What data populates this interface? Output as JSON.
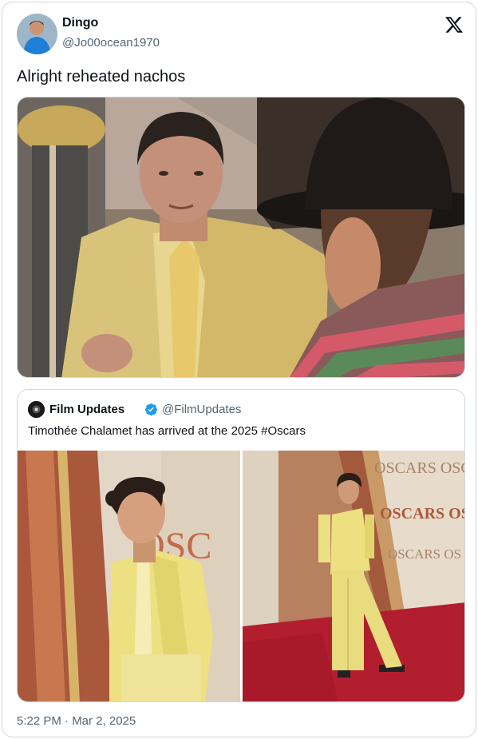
{
  "tweet": {
    "display_name": "Dingo",
    "handle": "@Jo00ocean1970",
    "text": "Alright reheated nachos",
    "timestamp": "5:22 PM · Mar 2, 2025",
    "logo_icon": "x-logo-icon",
    "avatar_icon": "avatar-icon",
    "media_photo": "movie-still-photo"
  },
  "quoted_tweet": {
    "display_name": "Film Updates",
    "verified_icon": "verified-badge-icon",
    "handle": "@FilmUpdates",
    "text": "Timothée Chalamet has arrived at the 2025 #Oscars",
    "media": [
      {
        "photo": "red-carpet-photo-closeup",
        "wall_text": "OSC"
      },
      {
        "photo": "red-carpet-photo-fullbody",
        "wall_text": [
          "OSCARS OSC",
          "OSCARS OSC",
          "OSCARS OS"
        ]
      }
    ]
  },
  "colors": {
    "accent": "#1d9bf0",
    "secondary_text": "#536471",
    "border": "#cfd9de"
  }
}
